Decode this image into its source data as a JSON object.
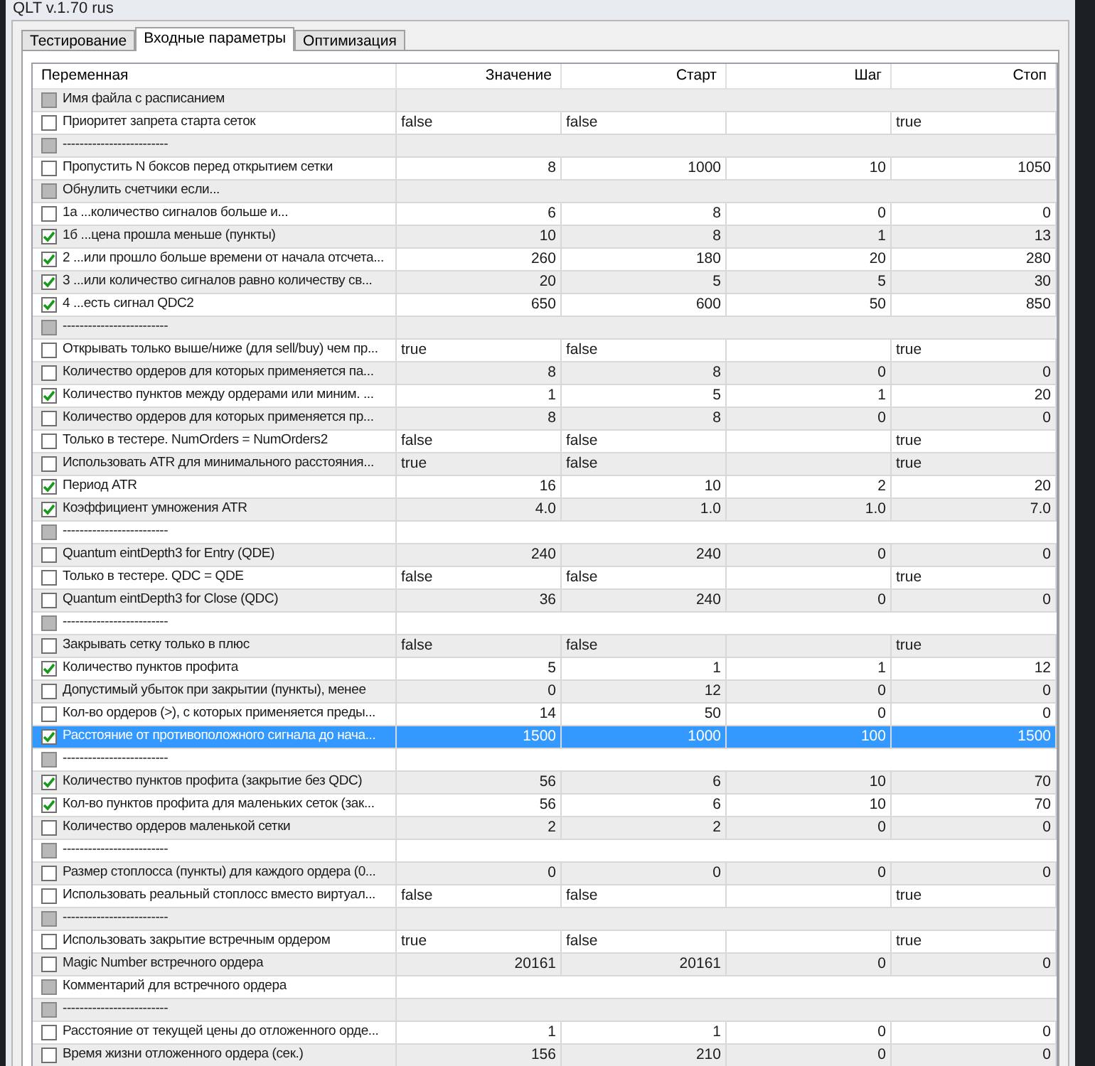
{
  "window": {
    "title": "QLT v.1.70 rus"
  },
  "tabs": [
    {
      "label": "Тестирование",
      "selected": false
    },
    {
      "label": "Входные параметры",
      "selected": true
    },
    {
      "label": "Оптимизация",
      "selected": false
    }
  ],
  "table": {
    "columns": [
      "Переменная",
      "Значение",
      "Старт",
      "Шаг",
      "Стоп"
    ],
    "rows": [
      {
        "kind": "section",
        "selected": false,
        "label": "Имя файла с расписанием"
      },
      {
        "kind": "boolean",
        "selected": false,
        "checked": false,
        "label": "Приоритет запрета старта сеток",
        "value": "false",
        "start": "false",
        "stop": "true"
      },
      {
        "kind": "section",
        "selected": false,
        "label": "-------------------------"
      },
      {
        "kind": "number",
        "selected": false,
        "checked": false,
        "label": "Пропустить N боксов перед открытием сетки",
        "value": "8",
        "start": "1000",
        "step": "10",
        "stop": "1050"
      },
      {
        "kind": "section",
        "selected": false,
        "label": "Обнулить счетчики если..."
      },
      {
        "kind": "number",
        "selected": false,
        "checked": false,
        "label": "1а ...количество сигналов больше и...",
        "value": "6",
        "start": "8",
        "step": "0",
        "stop": "0"
      },
      {
        "kind": "number",
        "selected": false,
        "checked": true,
        "label": "1б ...цена прошла меньше (пункты)",
        "value": "10",
        "start": "8",
        "step": "1",
        "stop": "13"
      },
      {
        "kind": "number",
        "selected": false,
        "checked": true,
        "label": "2 ...или прошло больше времени от начала отсчета...",
        "value": "260",
        "start": "180",
        "step": "20",
        "stop": "280"
      },
      {
        "kind": "number",
        "selected": false,
        "checked": true,
        "label": "3 ...или количество сигналов равно количеству св...",
        "value": "20",
        "start": "5",
        "step": "5",
        "stop": "30"
      },
      {
        "kind": "number",
        "selected": false,
        "checked": true,
        "label": "4 ...есть сигнал QDC2",
        "value": "650",
        "start": "600",
        "step": "50",
        "stop": "850"
      },
      {
        "kind": "section",
        "selected": false,
        "label": "-------------------------"
      },
      {
        "kind": "boolean",
        "selected": false,
        "checked": false,
        "label": "Открывать только выше/ниже (для sell/buy) чем пр...",
        "value": "true",
        "start": "false",
        "stop": "true"
      },
      {
        "kind": "number",
        "selected": false,
        "checked": false,
        "label": "Количество ордеров для которых применяется па...",
        "value": "8",
        "start": "8",
        "step": "0",
        "stop": "0"
      },
      {
        "kind": "number",
        "selected": false,
        "checked": true,
        "label": "Количество пунктов между ордерами или миним. ...",
        "value": "1",
        "start": "5",
        "step": "1",
        "stop": "20"
      },
      {
        "kind": "number",
        "selected": false,
        "checked": false,
        "label": "Количество ордеров для которых применяется пр...",
        "value": "8",
        "start": "8",
        "step": "0",
        "stop": "0"
      },
      {
        "kind": "boolean",
        "selected": false,
        "checked": false,
        "label": "Только в тестере. NumOrders = NumOrders2",
        "value": "false",
        "start": "false",
        "stop": "true"
      },
      {
        "kind": "boolean",
        "selected": false,
        "checked": false,
        "label": "Использовать ATR для минимального расстояния...",
        "value": "true",
        "start": "false",
        "stop": "true"
      },
      {
        "kind": "number",
        "selected": false,
        "checked": true,
        "label": "Период ATR",
        "value": "16",
        "start": "10",
        "step": "2",
        "stop": "20"
      },
      {
        "kind": "number",
        "selected": false,
        "checked": true,
        "label": "Коэффициент умножения ATR",
        "value": "4.0",
        "start": "1.0",
        "step": "1.0",
        "stop": "7.0"
      },
      {
        "kind": "section",
        "selected": false,
        "label": "-------------------------"
      },
      {
        "kind": "number",
        "selected": false,
        "checked": false,
        "label": "Quantum eintDepth3 for Entry (QDE)",
        "value": "240",
        "start": "240",
        "step": "0",
        "stop": "0"
      },
      {
        "kind": "boolean",
        "selected": false,
        "checked": false,
        "label": "Только в тестере. QDC = QDE",
        "value": "false",
        "start": "false",
        "stop": "true"
      },
      {
        "kind": "number",
        "selected": false,
        "checked": false,
        "label": "Quantum eintDepth3 for Close (QDC)",
        "value": "36",
        "start": "240",
        "step": "0",
        "stop": "0"
      },
      {
        "kind": "section",
        "selected": false,
        "label": "-------------------------"
      },
      {
        "kind": "boolean",
        "selected": false,
        "checked": false,
        "label": "Закрывать сетку только в плюс",
        "value": "false",
        "start": "false",
        "stop": "true"
      },
      {
        "kind": "number",
        "selected": false,
        "checked": true,
        "label": "Количество пунктов профита",
        "value": "5",
        "start": "1",
        "step": "1",
        "stop": "12"
      },
      {
        "kind": "number",
        "selected": false,
        "checked": false,
        "label": "Допустимый убыток при закрытии (пункты), менее",
        "value": "0",
        "start": "12",
        "step": "0",
        "stop": "0"
      },
      {
        "kind": "number",
        "selected": false,
        "checked": false,
        "label": "Кол-во ордеров (>), с которых применяется преды...",
        "value": "14",
        "start": "50",
        "step": "0",
        "stop": "0"
      },
      {
        "kind": "number",
        "selected": true,
        "checked": true,
        "label": "Расстояние от противоположного сигнала до нача...",
        "value": "1500",
        "start": "1000",
        "step": "100",
        "stop": "1500"
      },
      {
        "kind": "section",
        "selected": false,
        "label": "-------------------------"
      },
      {
        "kind": "number",
        "selected": false,
        "checked": true,
        "label": "Количество пунктов профита (закрытие без QDC)",
        "value": "56",
        "start": "6",
        "step": "10",
        "stop": "70"
      },
      {
        "kind": "number",
        "selected": false,
        "checked": true,
        "label": "Кол-во пунктов профита для маленьких сеток (зак...",
        "value": "56",
        "start": "6",
        "step": "10",
        "stop": "70"
      },
      {
        "kind": "number",
        "selected": false,
        "checked": false,
        "label": "Количество ордеров маленькой сетки",
        "value": "2",
        "start": "2",
        "step": "0",
        "stop": "0"
      },
      {
        "kind": "section",
        "selected": false,
        "label": "-------------------------"
      },
      {
        "kind": "number",
        "selected": false,
        "checked": false,
        "label": "Размер стоплосса (пункты) для каждого ордера (0...",
        "value": "0",
        "start": "0",
        "step": "0",
        "stop": "0"
      },
      {
        "kind": "boolean",
        "selected": false,
        "checked": false,
        "label": "Использовать реальный стоплосс вместо виртуал...",
        "value": "false",
        "start": "false",
        "stop": "true"
      },
      {
        "kind": "section",
        "selected": false,
        "label": "-------------------------"
      },
      {
        "kind": "boolean",
        "selected": false,
        "checked": false,
        "label": "Использовать закрытие встречным ордером",
        "value": "true",
        "start": "false",
        "stop": "true"
      },
      {
        "kind": "number",
        "selected": false,
        "checked": false,
        "label": "Magic Number встречного ордера",
        "value": "20161",
        "start": "20161",
        "step": "0",
        "stop": "0"
      },
      {
        "kind": "section",
        "selected": false,
        "label": "Комментарий для встречного ордера"
      },
      {
        "kind": "section",
        "selected": false,
        "label": "-------------------------"
      },
      {
        "kind": "number",
        "selected": false,
        "checked": false,
        "label": "Расстояние от текущей цены до отложенного орде...",
        "value": "1",
        "start": "1",
        "step": "0",
        "stop": "0"
      },
      {
        "kind": "number",
        "selected": false,
        "checked": false,
        "label": "Время жизни отложенного ордера (сек.)",
        "value": "156",
        "start": "210",
        "step": "0",
        "stop": "0"
      }
    ]
  }
}
